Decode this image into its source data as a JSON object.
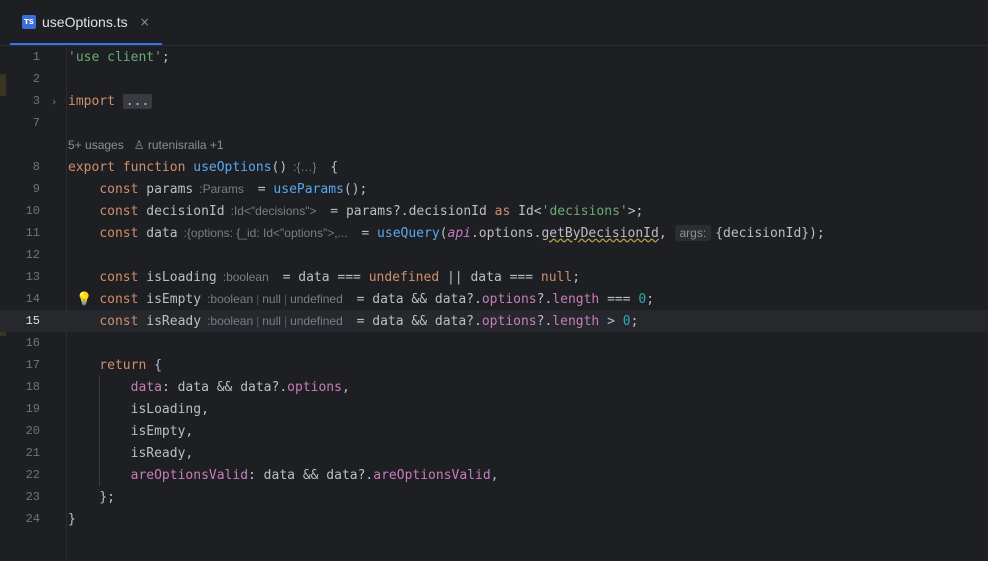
{
  "tab": {
    "title": "useOptions.ts",
    "close": "×",
    "icon": "TS"
  },
  "meta": {
    "usages": "5+ usages",
    "author": "rutenisraila +1"
  },
  "lines": {
    "l1": {
      "num": "1",
      "str": "'use client'",
      "semi": ";"
    },
    "l2": {
      "num": "2"
    },
    "l3": {
      "num": "3",
      "kw": "import",
      "fold": "..."
    },
    "l7": {
      "num": "7"
    },
    "l8": {
      "num": "8",
      "export": "export",
      "function": "function",
      "name": "useOptions",
      "paren": "()",
      "hint": ":{…}",
      "brace": "{"
    },
    "l9": {
      "num": "9",
      "const": "const",
      "var": "params",
      "hint": ":Params",
      "eq": "= ",
      "call": "useParams",
      "rest": "();"
    },
    "l10": {
      "num": "10",
      "const": "const",
      "var": "decisionId",
      "hint": ":Id<\"decisions\">",
      "pre": "= params?.decisionId ",
      "as": "as",
      "mid": " Id<",
      "str": "'decisions'",
      "post": ">;"
    },
    "l11": {
      "num": "11",
      "const": "const",
      "var": "data",
      "hint": ":{options: {_id: Id<\"options\">,...",
      "eq": "= ",
      "call": "useQuery",
      "open": "(",
      "api": "api",
      "mid": ".options.",
      "getter": "getByDecisionId",
      "comma": ",",
      "args": "args:",
      "rest": "{decisionId});"
    },
    "l12": {
      "num": "12"
    },
    "l13": {
      "num": "13",
      "const": "const",
      "var": "isLoading",
      "hint": ":boolean",
      "pre": "= data === ",
      "undef": "undefined",
      "mid": " || data === ",
      "null": "null",
      "semi": ";"
    },
    "l14": {
      "num": "14",
      "const": "const",
      "var": "isEmpty",
      "hint1": ":boolean",
      "hint2": "null",
      "hint3": "undefined",
      "pre": "= data && data?.",
      "options": "options",
      "q": "?.",
      "length": "length",
      "op": " === ",
      "zero": "0",
      "semi": ";"
    },
    "l15": {
      "num": "15",
      "const": "const",
      "var": "isReady",
      "hint1": ":boolean",
      "hint2": "null",
      "hint3": "undefined",
      "pre": "= data && data?.",
      "options": "options",
      "q": "?.",
      "length": "length",
      "op": " > ",
      "zero": "0",
      "semi": ";"
    },
    "l16": {
      "num": "16"
    },
    "l17": {
      "num": "17",
      "kw": "return",
      "rest": " {"
    },
    "l18": {
      "num": "18",
      "prop": "data",
      "rest": ": data && data?.",
      "prop2": "options",
      "end": ","
    },
    "l19": {
      "num": "19",
      "text": "isLoading,"
    },
    "l20": {
      "num": "20",
      "text": "isEmpty,"
    },
    "l21": {
      "num": "21",
      "text": "isReady,"
    },
    "l22": {
      "num": "22",
      "prop": "areOptionsValid",
      "rest": ": data && data?.",
      "prop2": "areOptionsValid",
      "end": ","
    },
    "l23": {
      "num": "23",
      "text": "};"
    },
    "l24": {
      "num": "24",
      "text": "}"
    }
  },
  "colors": {
    "background": "#1e1f22",
    "keyword": "#cf8e6d",
    "string": "#6aab73",
    "function": "#56a8f5",
    "property": "#c77dbb",
    "number": "#2aacb8",
    "tab_accent": "#3574f0"
  },
  "icons": {
    "bulb": "lightbulb-icon",
    "fold": "chevron-right-icon",
    "user": "user-icon"
  }
}
